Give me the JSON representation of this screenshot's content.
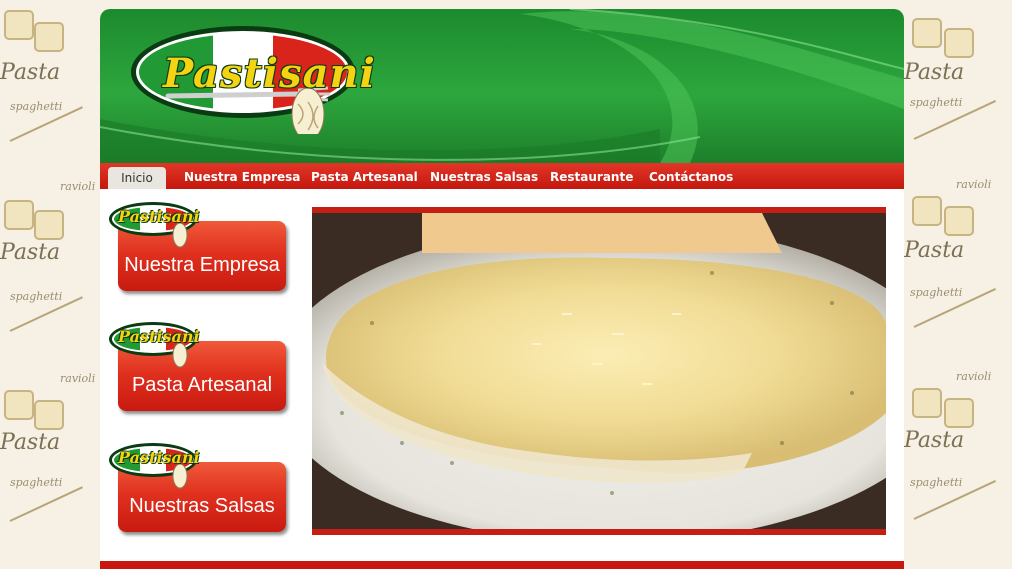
{
  "site": {
    "brand": "Pastisani",
    "background_words": [
      "ravioli",
      "Pasta",
      "spaghetti"
    ],
    "colors": {
      "green": "#2da73d",
      "red": "#c9170f",
      "yellow": "#f4d312",
      "white": "#ffffff"
    }
  },
  "nav": {
    "items": [
      {
        "label": "Inicio",
        "active": true
      },
      {
        "label": "Nuestra Empresa"
      },
      {
        "label": "Pasta Artesanal"
      },
      {
        "label": "Nuestras Salsas"
      },
      {
        "label": "Restaurante"
      },
      {
        "label": "Contáctanos"
      }
    ]
  },
  "sidebar": {
    "cards": [
      {
        "label": "Nuestra Empresa"
      },
      {
        "label": "Pasta Artesanal"
      },
      {
        "label": "Nuestras Salsas"
      }
    ]
  },
  "hero": {
    "image": "ravioli-with-cream-sauce-photo"
  }
}
